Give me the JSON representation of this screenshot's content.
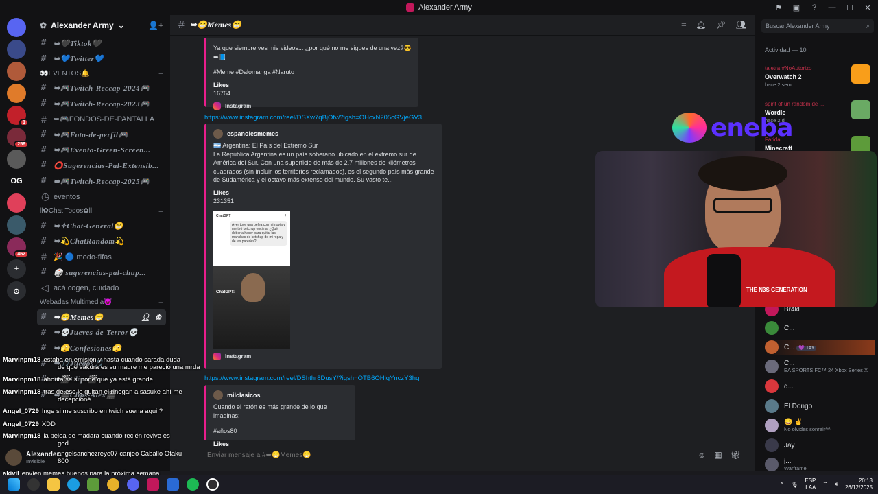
{
  "window": {
    "title": "Alexander Army"
  },
  "servers": [
    {
      "label": "",
      "color": "#5865f2",
      "icon": "discord-icon"
    },
    {
      "label": "",
      "color": "#3a4a8a"
    },
    {
      "label": "",
      "color": "#b05a3a"
    },
    {
      "label": "",
      "color": "#e07b2a"
    },
    {
      "label": "",
      "color": "#c2202a",
      "badge": "1"
    },
    {
      "label": "",
      "color": "#7a2a3a",
      "badge": "256"
    },
    {
      "label": "",
      "color": "#5a5a5a"
    },
    {
      "label": "OG",
      "color": "#121214"
    },
    {
      "label": "",
      "color": "#e0405a"
    },
    {
      "label": "",
      "color": "#3a5a6a"
    },
    {
      "label": "",
      "color": "#8a2a5a",
      "badge": "462"
    }
  ],
  "guild": {
    "name": "Alexander Army"
  },
  "channels": {
    "top": [
      "➥🖤Tiktok🖤",
      "➥💙Twitter💙"
    ],
    "cat_eventos": "👀EVENTOS🔔",
    "eventos": [
      "➥🎮Twitch-Reccap-2024🎮",
      "➥🎮Twitch-Reccap-2023🎮",
      "➥🎮FONDOS-DE-PANTALLA",
      "➥🎮Foto-de-perfil🎮",
      "➥🎮Evento-Green-Screen...",
      "⭕Sugerencias-Pal-Extensib...",
      "➥🎮Twitch-Reccap-2025🎮"
    ],
    "eventos_link": "eventos",
    "cat_chat": "ll✿Chat Todos✿ll",
    "chat": [
      "➥✧Chat-General😁",
      "➥💫ChatRandom💫",
      "🎉 🔵 modo-fifas",
      "🎲 sugerencias-pal-chup...",
      "acá cogen, cuidado"
    ],
    "cat_webadas": "Webadas Multimedia😈",
    "webadas": [
      "➥😁Memes😁",
      "➥💀Jueves-de-Terror💀",
      "➥🫣Confesiones🫣",
      "➥🎵Juegos🎵",
      "➥🎬Clips🎬",
      "➥🎬Clips-Alex🎬"
    ]
  },
  "header": {
    "channel": "➥😁Memes😁",
    "search_placeholder": "Buscar Alexander Army"
  },
  "messages": {
    "embed1": {
      "text": "Ya que siempre ves mis videos... ¿por qué no me sigues de una vez?😎➡📘",
      "tags": "#Meme #Dalomanga #Naruto",
      "likes_label": "Likes",
      "likes": "16764",
      "footer": "Instagram"
    },
    "link1": "https://www.instagram.com/reel/DSXw7qBjOfv/?igsh=OHcxN205cGVjeGV3",
    "embed2": {
      "author": "espanolesmemes",
      "title": "🇦🇷 Argentina: El País del Extremo Sur",
      "body": "La República Argentina es un país soberano ubicado en el extremo sur de América del Sur. Con una superficie de más de 2.7 millones de kilómetros cuadrados (sin incluir los territorios reclamados), es el segundo país más grande de Sudamérica y el octavo más extenso del mundo. Su vasto te...",
      "likes_label": "Likes",
      "likes": "231351",
      "footer": "Instagram",
      "img_top": "ChatGPT",
      "img_question": "Ayer tuve una pelea con mi novia y me tiró ketchup encima. ¿Qué debería hacer para quitar las manchas de ketchup de mi ropa y de las paredes?",
      "img_caption": "ChatGPT:"
    },
    "link2": "https://www.instagram.com/reel/DShthr8DusY/?igsh=OTB6OHlqYnczY3hq",
    "embed3": {
      "author": "milclasicos",
      "text": "Cuando el ratón es más grande de lo que imaginas:",
      "tags": "#años80",
      "likes_label": "Likes"
    }
  },
  "composer": {
    "placeholder": "Enviar mensaje a #➥😁Memes😁"
  },
  "activity": {
    "title": "Actividad — 10",
    "items": [
      {
        "who": "taletra #NoAutorizo",
        "game": "Overwatch 2",
        "when": "hace 2 sem.",
        "color": "#f99e1a"
      },
      {
        "who": "spirit of un random de ...",
        "game": "Wordle",
        "when": "hace 2 d",
        "color": "#6aaa64"
      },
      {
        "who": "Farida",
        "game": "Minecraft",
        "when": "",
        "color": "#5d9b3a"
      }
    ]
  },
  "members": [
    {
      "name": "Br4kl",
      "sub": "",
      "color": "#c2185b"
    },
    {
      "name": "C...",
      "sub": "",
      "color": "#3a8a3a"
    },
    {
      "name": "C...",
      "sub": "",
      "color": "#c06030",
      "tag": "💜 TAY"
    },
    {
      "name": "C...",
      "sub": "EA SPORTS FC™ 24 Xbox Series X",
      "color": "#6a6a7a"
    },
    {
      "name": "d...",
      "sub": "",
      "color": "#da373c"
    },
    {
      "name": "El Dongo",
      "sub": "",
      "color": "#5a7a8a"
    },
    {
      "name": "😀 ✌",
      "sub": "No olvides sonreír^^",
      "color": "#b0a0c0"
    },
    {
      "name": "Jay",
      "sub": "",
      "color": "#3a3a4a"
    },
    {
      "name": "j...",
      "sub": "Warframe",
      "color": "#5a5a6a"
    }
  ],
  "sponsor": {
    "word": "eneba"
  },
  "cam": {
    "shirt_text": "THE N3S GENERATION"
  },
  "overlay_chat": [
    {
      "user": "Marvinpm18",
      "msg": "estaba en emisión y hasta cuando sarada duda"
    },
    {
      "user": "",
      "msg": "de que sakura es su madre me pareció una mrda"
    },
    {
      "user": "Marvinpm18",
      "msg": "ahorita se supone que ya está grande"
    },
    {
      "user": "Marvinpm18",
      "msg": "tras de eso le quitan el rinegan a sasuke ahí me"
    },
    {
      "user": "",
      "msg": "decepcioné"
    },
    {
      "user": "Angel_0729",
      "msg": "Inge si me suscribo en twich suena aqui ?"
    },
    {
      "user": "Angel_0729",
      "msg": "XDD"
    },
    {
      "user": "Marvinpm18",
      "msg": "la pelea de madara cuando recién revive es"
    },
    {
      "user": "",
      "msg": "god"
    },
    {
      "user": "",
      "msg": "angelsanchezreye07 canjeó Caballo Otaku"
    },
    {
      "user": "",
      "msg": "800"
    },
    {
      "user": "akivil",
      "msg": "envíen memes buenos para la próxima semana"
    },
    {
      "user": "Angel_0729",
      "msg": "Ya me suscribí XD"
    }
  ],
  "user_panel": {
    "name": "Alexander",
    "status": "Invisible"
  },
  "taskbar": {
    "lang1": "ESP",
    "lang2": "LAA",
    "time": "20:13",
    "date": "26/12/2025"
  }
}
